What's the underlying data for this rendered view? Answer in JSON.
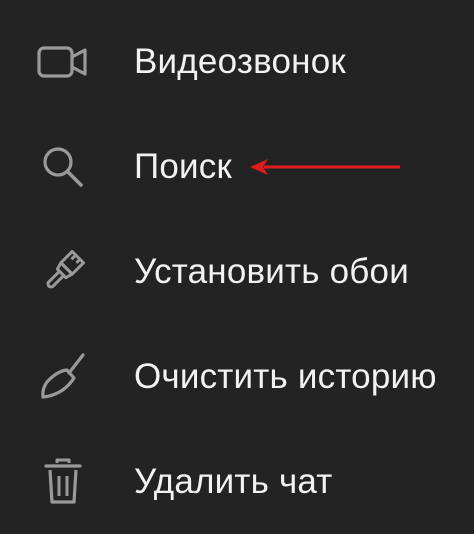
{
  "menu": {
    "items": [
      {
        "label": "Видеозвонок",
        "icon": "video-camera-icon"
      },
      {
        "label": "Поиск",
        "icon": "search-icon"
      },
      {
        "label": "Установить обои",
        "icon": "paintbrush-icon"
      },
      {
        "label": "Очистить историю",
        "icon": "broom-icon"
      },
      {
        "label": "Удалить чат",
        "icon": "trash-icon"
      }
    ]
  },
  "annotation": {
    "arrow_color": "#e01b1b",
    "points_to": "Поиск"
  },
  "colors": {
    "background": "#232323",
    "text": "#f2f2f2",
    "icon": "#9a9a9a"
  }
}
